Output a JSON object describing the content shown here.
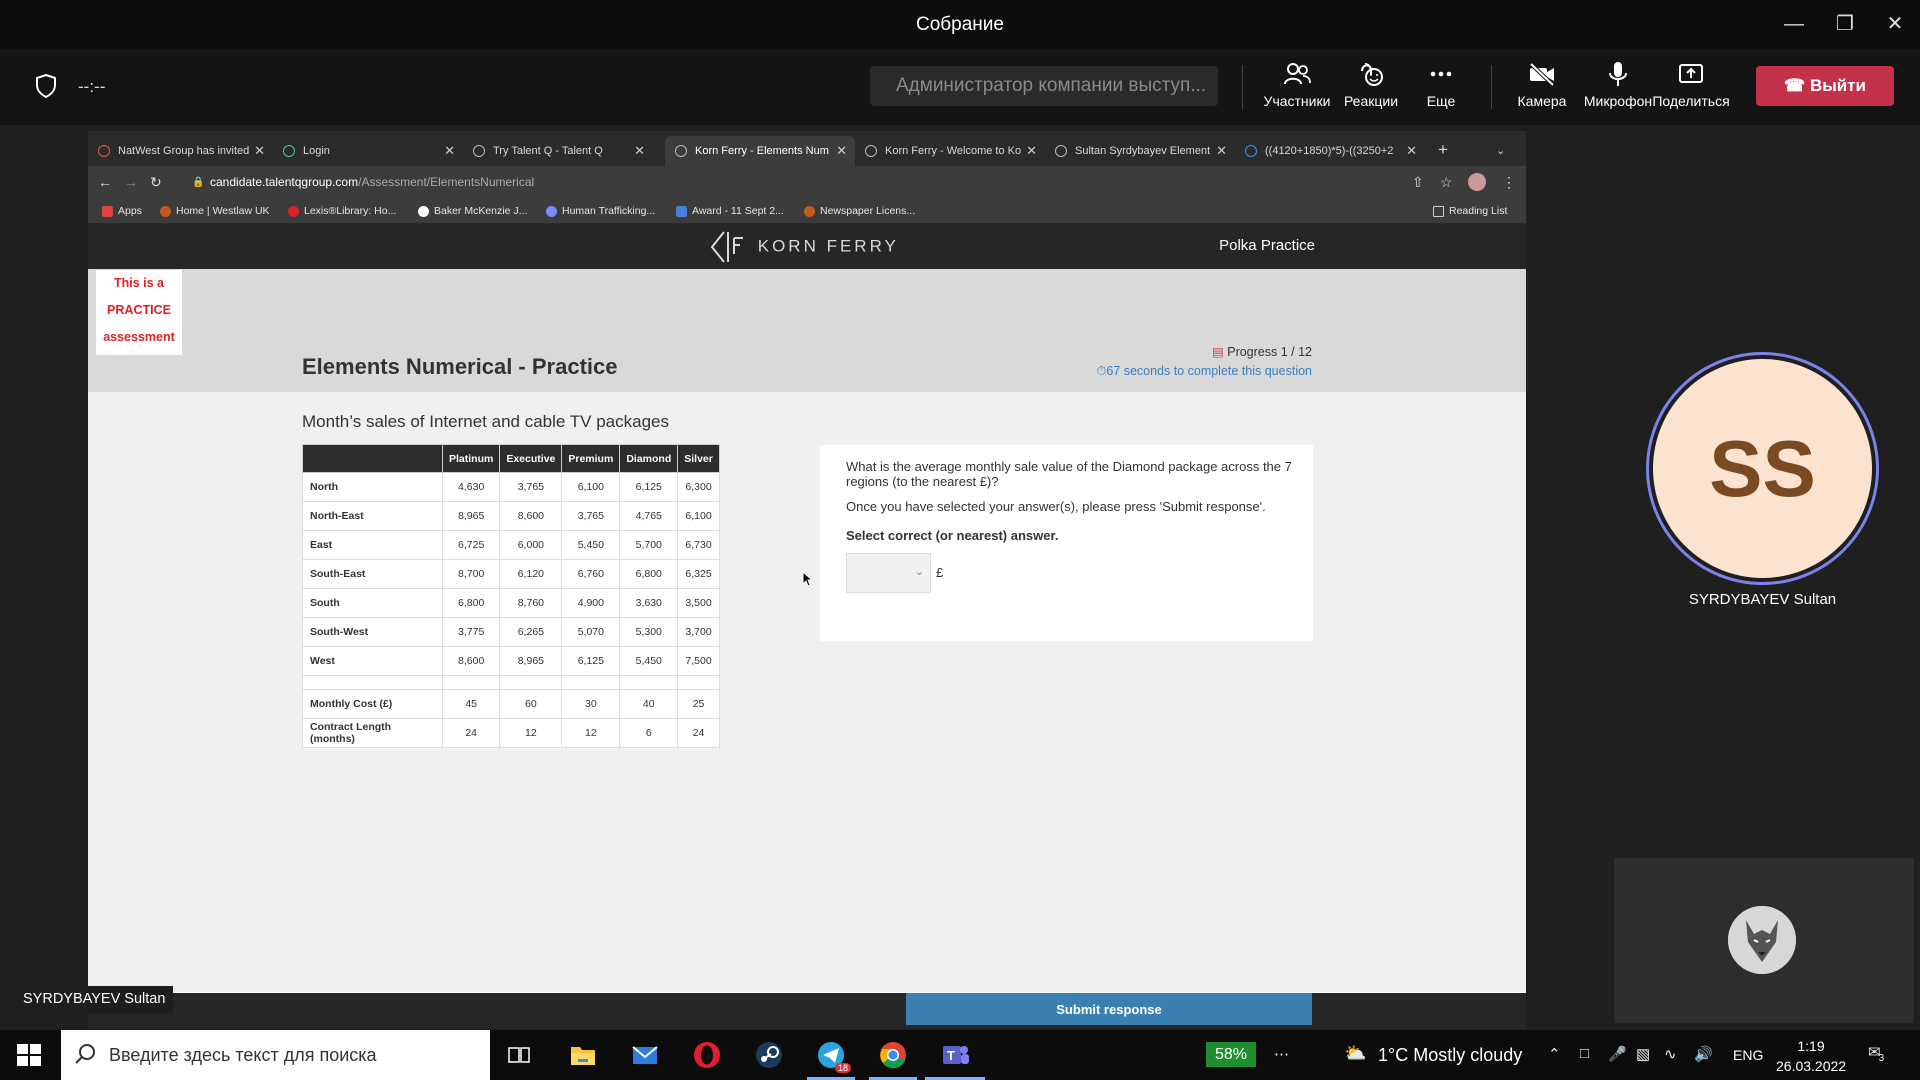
{
  "teams": {
    "window_title": "Собрание",
    "meeting_timer": "--:--",
    "presenter_banner": "Администратор компании выступ...",
    "buttons": {
      "participants": "Участники",
      "reactions": "Реакции",
      "more": "Еще",
      "camera": "Камера",
      "mic": "Микрофон",
      "share": "Поделиться",
      "leave": "Выйти"
    },
    "participant": {
      "initials": "SS",
      "name": "SYRDYBAYEV Sultan"
    },
    "name_label": "SYRDYBAYEV Sultan"
  },
  "browser": {
    "tabs": [
      {
        "label": "NatWest Group has invited"
      },
      {
        "label": "Login"
      },
      {
        "label": "Try Talent Q - Talent Q"
      },
      {
        "label": "Korn Ferry - Elements Num"
      },
      {
        "label": "Korn Ferry - Welcome to Ko"
      },
      {
        "label": "Sultan Syrdybayev Element"
      },
      {
        "label": "((4120+1850)*5)-((3250+2"
      }
    ],
    "url_host": "candidate.talentqgroup.com",
    "url_path": "/Assessment/ElementsNumerical",
    "bookmarks": [
      {
        "label": "Apps"
      },
      {
        "label": "Home | Westlaw UK"
      },
      {
        "label": "Lexis®Library: Ho..."
      },
      {
        "label": "Baker McKenzie J..."
      },
      {
        "label": "Human Trafficking..."
      },
      {
        "label": "Award - 11 Sept 2..."
      },
      {
        "label": "Newspaper Licens..."
      }
    ],
    "reading_list": "Reading List"
  },
  "page": {
    "brand": "KORN FERRY",
    "org": "Polka Practice",
    "practice_badge": [
      "This is a",
      "PRACTICE",
      "assessment"
    ],
    "title": "Elements Numerical - Practice",
    "progress": "Progress 1 / 12",
    "timer": "67 seconds to complete this question",
    "table_title": "Month’s sales of Internet and cable TV packages",
    "table": {
      "headers": [
        "",
        "Platinum",
        "Executive",
        "Premium",
        "Diamond",
        "Silver"
      ],
      "rows": [
        [
          "North",
          "4,630",
          "3,765",
          "6,100",
          "6,125",
          "6,300"
        ],
        [
          "North-East",
          "8,965",
          "8,600",
          "3,765",
          "4,765",
          "6,100"
        ],
        [
          "East",
          "6,725",
          "6,000",
          "5,450",
          "5,700",
          "6,730"
        ],
        [
          "South-East",
          "8,700",
          "6,120",
          "6,760",
          "6,800",
          "6,325"
        ],
        [
          "South",
          "6,800",
          "8,760",
          "4,900",
          "3,630",
          "3,500"
        ],
        [
          "South-West",
          "3,775",
          "6,265",
          "5,070",
          "5,300",
          "3,700"
        ],
        [
          "West",
          "8,600",
          "8,965",
          "6,125",
          "5,450",
          "7,500"
        ]
      ],
      "footer_rows": [
        [
          "Monthly Cost (£)",
          "45",
          "60",
          "30",
          "40",
          "25"
        ],
        [
          "Contract Length (months)",
          "24",
          "12",
          "12",
          "6",
          "24"
        ]
      ]
    },
    "question": "What is the average monthly sale value of the Diamond package across the 7 regions (to the nearest £)?",
    "instruction": "Once you have selected your answer(s), please press 'Submit response'.",
    "select_label": "Select correct (or nearest) answer.",
    "currency": "£",
    "submit": "Submit response"
  },
  "taskbar": {
    "search_placeholder": "Введите здесь текст для поиска",
    "battery": "58%",
    "weather": "1°C  Mostly cloudy",
    "language": "ENG",
    "time": "1:19",
    "date": "26.03.2022",
    "telegram_badge": "18",
    "notifications": "3"
  },
  "colors": {
    "leave": "#c4314b",
    "submit": "#3b80b3",
    "practice": "#e02020",
    "ring": "#7b83eb"
  }
}
